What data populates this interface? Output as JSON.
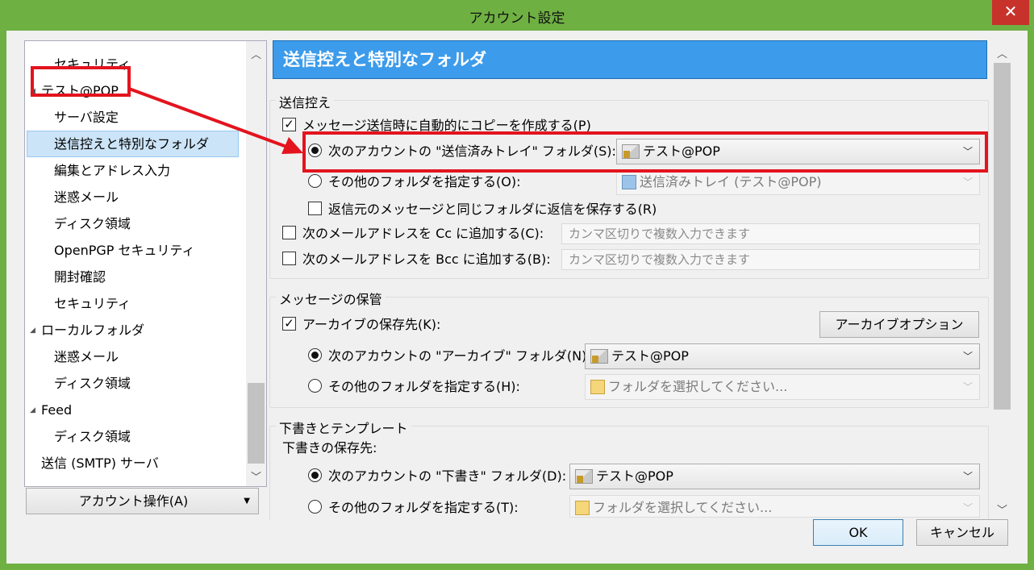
{
  "window": {
    "title": "アカウント設定",
    "close_glyph": "✕"
  },
  "tree": {
    "items": [
      {
        "label": "セキュリティ"
      },
      {
        "label": "テスト@POP"
      },
      {
        "label": "サーバ設定"
      },
      {
        "label": "送信控えと特別なフォルダ"
      },
      {
        "label": "編集とアドレス入力"
      },
      {
        "label": "迷惑メール"
      },
      {
        "label": "ディスク領域"
      },
      {
        "label": "OpenPGP セキュリティ"
      },
      {
        "label": "開封確認"
      },
      {
        "label": "セキュリティ"
      },
      {
        "label": "ローカルフォルダ"
      },
      {
        "label": "迷惑メール"
      },
      {
        "label": "ディスク領域"
      },
      {
        "label": "Feed"
      },
      {
        "label": "ディスク領域"
      },
      {
        "label": "送信 (SMTP) サーバ"
      }
    ],
    "account_button": "アカウント操作(A)"
  },
  "panel": {
    "title": "送信控えと特別なフォルダ"
  },
  "sent_group": {
    "label": "送信控え",
    "copy_check": "メッセージ送信時に自動的にコピーを作成する(P)",
    "radio_account": "次のアカウントの \"送信済みトレイ\" フォルダ(S):",
    "account_value": "テスト@POP",
    "radio_other": "その他のフォルダを指定する(O):",
    "other_value": "送信済みトレイ (テスト@POP)",
    "reply_check": "返信元のメッセージと同じフォルダに返信を保存する(R)",
    "cc_check": "次のメールアドレスを Cc に追加する(C):",
    "cc_placeholder": "カンマ区切りで複数入力できます",
    "bcc_check": "次のメールアドレスを Bcc に追加する(B):",
    "bcc_placeholder": "カンマ区切りで複数入力できます"
  },
  "archive_group": {
    "label": "メッセージの保管",
    "archive_check": "アーカイブの保存先(K):",
    "options_button": "アーカイブオプション(A)...",
    "radio_account": "次のアカウントの \"アーカイブ\" フォルダ(N):",
    "account_value": "テスト@POP",
    "radio_other": "その他のフォルダを指定する(H):",
    "other_value": "フォルダを選択してください..."
  },
  "drafts_group": {
    "label": "下書きとテンプレート",
    "drafts_label": "下書きの保存先:",
    "radio_account": "次のアカウントの \"下書き\" フォルダ(D):",
    "account_value": "テスト@POP",
    "radio_other": "その他のフォルダを指定する(T):",
    "other_value": "フォルダを選択してください..."
  },
  "footer": {
    "ok": "OK",
    "cancel": "キャンセル"
  },
  "colors": {
    "frame": "#6fb043",
    "header": "#3c9bea",
    "highlight": "#e3141e",
    "selection": "#cce4f7"
  }
}
